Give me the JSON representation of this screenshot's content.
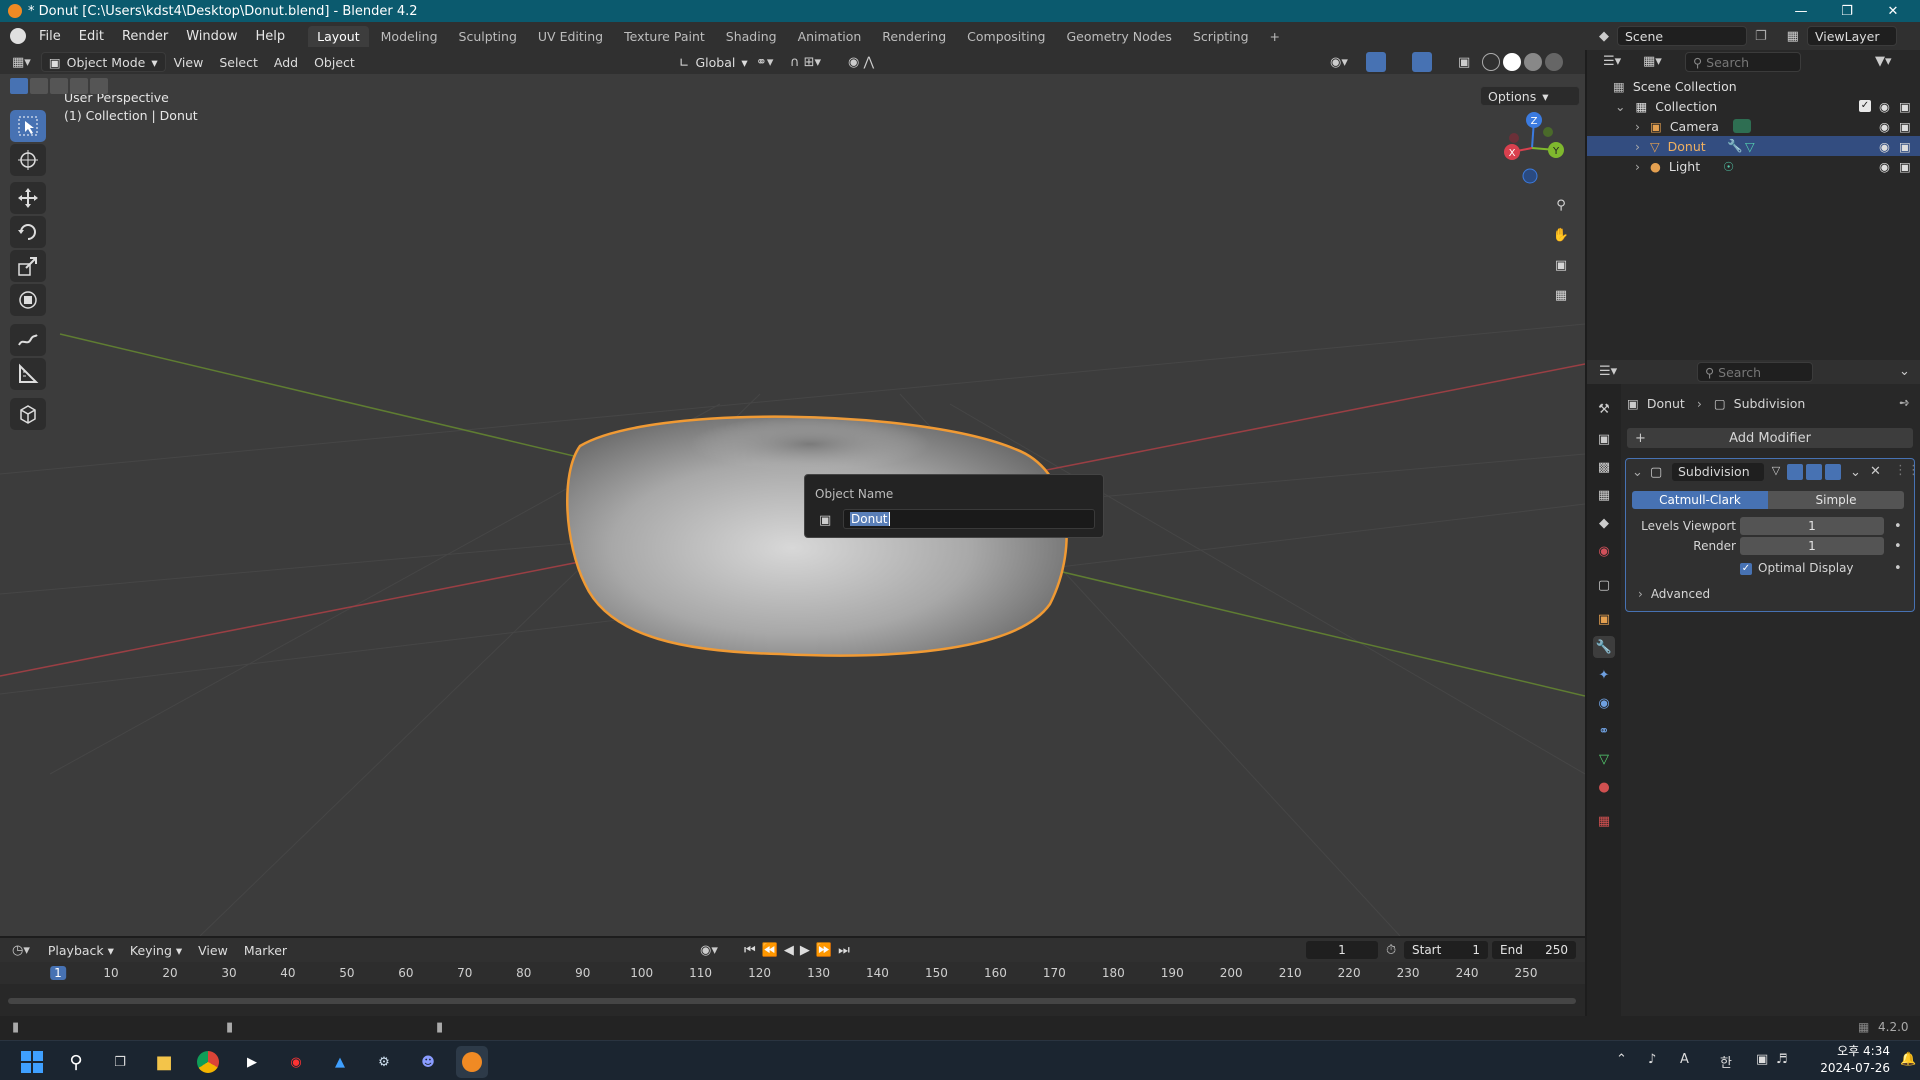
{
  "window": {
    "title": "* Donut [C:\\Users\\kdst4\\Desktop\\Donut.blend] - Blender 4.2"
  },
  "menu": [
    "File",
    "Edit",
    "Render",
    "Window",
    "Help"
  ],
  "workspaces": [
    "Layout",
    "Modeling",
    "Sculpting",
    "UV Editing",
    "Texture Paint",
    "Shading",
    "Animation",
    "Rendering",
    "Compositing",
    "Geometry Nodes",
    "Scripting"
  ],
  "active_workspace": "Layout",
  "scene": {
    "name": "Scene",
    "view_layer": "ViewLayer"
  },
  "viewport_header": {
    "mode": "Object Mode",
    "menus": [
      "View",
      "Select",
      "Add",
      "Object"
    ],
    "orientation": "Global",
    "options": "Options"
  },
  "viewport": {
    "perspective": "User Perspective",
    "context": "(1) Collection | Donut",
    "gizmo": {
      "x": "X",
      "y": "Y",
      "z": "Z"
    }
  },
  "dialog": {
    "title": "Object Name",
    "value": "Donut"
  },
  "outliner": {
    "search_placeholder": "Search",
    "root": "Scene Collection",
    "collection": "Collection",
    "items": [
      {
        "label": "Camera",
        "selected": false
      },
      {
        "label": "Donut",
        "selected": true
      },
      {
        "label": "Light",
        "selected": false
      }
    ]
  },
  "properties": {
    "search_placeholder": "Search",
    "breadcrumb_object": "Donut",
    "breadcrumb_modifier": "Subdivision",
    "add_modifier": "Add Modifier",
    "modifier": {
      "name": "Subdivision",
      "type_options": [
        "Catmull-Clark",
        "Simple"
      ],
      "active_type": "Catmull-Clark",
      "levels_viewport_label": "Levels Viewport",
      "levels_viewport": "1",
      "render_label": "Render",
      "render": "1",
      "optimal_display_label": "Optimal Display",
      "optimal_display": true,
      "advanced_label": "Advanced"
    }
  },
  "timeline": {
    "menus": [
      "Playback",
      "Keying",
      "View",
      "Marker"
    ],
    "current_frame": "1",
    "start_label": "Start",
    "start": "1",
    "end_label": "End",
    "end": "250",
    "ruler_labels": [
      "1",
      "10",
      "20",
      "30",
      "40",
      "50",
      "60",
      "70",
      "80",
      "90",
      "100",
      "110",
      "120",
      "130",
      "140",
      "150",
      "160",
      "170",
      "180",
      "190",
      "200",
      "210",
      "220",
      "230",
      "240",
      "250"
    ]
  },
  "status": {
    "version": "4.2.0"
  },
  "taskbar": {
    "clock_ampm": "오후 4:34",
    "date": "2024-07-26",
    "ime": "A",
    "ime2": "한"
  },
  "colors": {
    "accent": "#4772b3",
    "selection_outline": "#f09a34",
    "title_bar": "#0b5a6e"
  }
}
